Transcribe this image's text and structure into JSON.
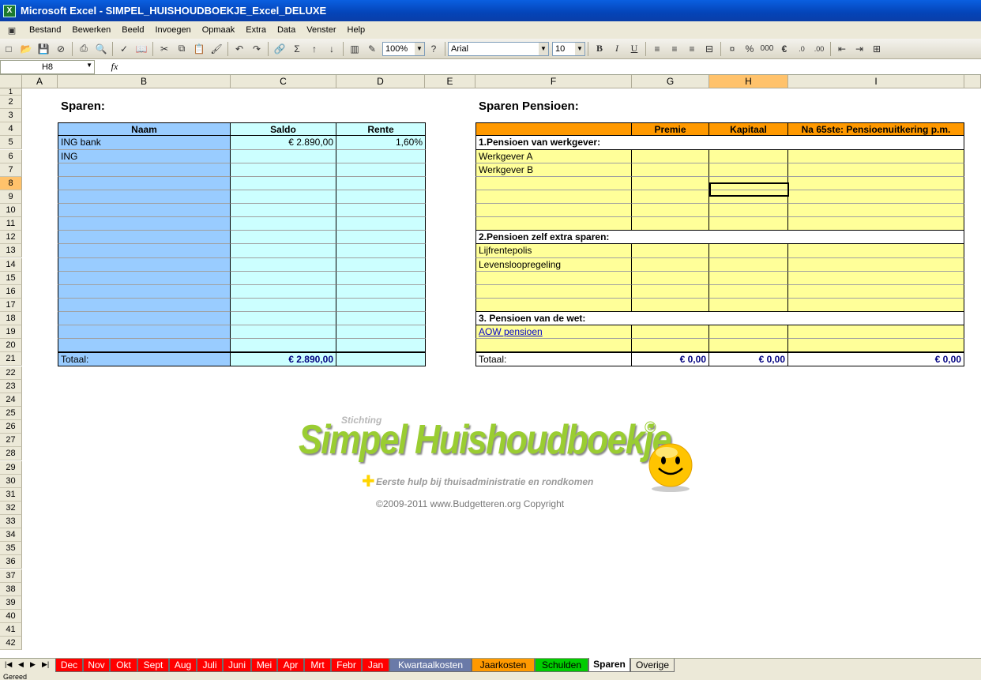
{
  "window": {
    "title": "Microsoft Excel - SIMPEL_HUISHOUDBOEKJE_Excel_DELUXE",
    "app_icon": "excel-icon"
  },
  "menu": [
    "Bestand",
    "Bewerken",
    "Beeld",
    "Invoegen",
    "Opmaak",
    "Extra",
    "Data",
    "Venster",
    "Help"
  ],
  "toolbar": {
    "zoom": "100%",
    "font": "Arial",
    "font_size": "10",
    "bold": "B",
    "italic": "I",
    "underline": "U",
    "percent": "%",
    "thousands": "000",
    "euro": "€"
  },
  "formula_bar": {
    "name_box": "H8",
    "fx": "fx",
    "content": ""
  },
  "columns": [
    "A",
    "B",
    "C",
    "D",
    "E",
    "F",
    "G",
    "H",
    "I"
  ],
  "selected_column": "H",
  "selected_row": 8,
  "rows": [
    "1",
    "2",
    "3",
    "4",
    "5",
    "6",
    "7",
    "8",
    "9",
    "10",
    "11",
    "12",
    "13",
    "14",
    "15",
    "16",
    "17",
    "18",
    "19",
    "20",
    "21",
    "22",
    "23",
    "24",
    "25",
    "26",
    "27",
    "28",
    "29",
    "30",
    "31",
    "32",
    "33",
    "34",
    "35",
    "36",
    "37",
    "38",
    "39",
    "40",
    "41",
    "42"
  ],
  "sparen": {
    "heading": "Sparen:",
    "headers": {
      "naam": "Naam",
      "saldo": "Saldo",
      "rente": "Rente"
    },
    "rows": [
      {
        "naam": "ING bank",
        "saldo": "€ 2.890,00",
        "rente": "1,60%"
      },
      {
        "naam": "ING",
        "saldo": "",
        "rente": ""
      }
    ],
    "total_label": "Totaal:",
    "total_saldo": "€ 2.890,00"
  },
  "pensioen": {
    "heading": "Sparen Pensioen:",
    "headers": {
      "premie": "Premie",
      "kapitaal": "Kapitaal",
      "uitkering": "Na 65ste: Pensioenuitkering p.m."
    },
    "section1": "1.Pensioen van werkgever:",
    "werkgever_a": "Werkgever A",
    "werkgever_b": "Werkgever B",
    "section2": "2.Pensioen zelf extra sparen:",
    "lijfrente": "Lijfrentepolis",
    "levensloop": "Levensloopregeling",
    "section3": "3. Pensioen van de wet:",
    "aow": "AOW pensioen",
    "total_label": "Totaal:",
    "total_premie": "€ 0,00",
    "total_kapitaal": "€ 0,00",
    "total_uitkering": "€ 0,00"
  },
  "logo": {
    "stichting": "Stichting",
    "title": "Simpel Huishoudboekje",
    "copyright_mark": "©",
    "tagline": "Eerste hulp bij thuisadministratie en rondkomen",
    "copyright": "©2009-2011 www.Budgetteren.org Copyright"
  },
  "tabs": [
    {
      "label": "Dec",
      "color": "#ff0000",
      "text": "#ffffff"
    },
    {
      "label": "Nov",
      "color": "#ff0000",
      "text": "#ffffff"
    },
    {
      "label": "Okt",
      "color": "#ff0000",
      "text": "#ffffff"
    },
    {
      "label": "Sept",
      "color": "#ff0000",
      "text": "#ffffff"
    },
    {
      "label": "Aug",
      "color": "#ff0000",
      "text": "#ffffff"
    },
    {
      "label": "Juli",
      "color": "#ff0000",
      "text": "#ffffff"
    },
    {
      "label": "Juni",
      "color": "#ff0000",
      "text": "#ffffff"
    },
    {
      "label": "Mei",
      "color": "#ff0000",
      "text": "#ffffff"
    },
    {
      "label": "Apr",
      "color": "#ff0000",
      "text": "#ffffff"
    },
    {
      "label": "Mrt",
      "color": "#ff0000",
      "text": "#ffffff"
    },
    {
      "label": "Febr",
      "color": "#ff0000",
      "text": "#ffffff"
    },
    {
      "label": "Jan",
      "color": "#ff0000",
      "text": "#ffffff"
    },
    {
      "label": "Kwartaalkosten",
      "color": "#6a7aa8",
      "text": "#ffffff"
    },
    {
      "label": "Jaarkosten",
      "color": "#ff9900",
      "text": "#000000"
    },
    {
      "label": "Schulden",
      "color": "#00cc00",
      "text": "#000000"
    },
    {
      "label": "Sparen",
      "color": "#ffffff",
      "text": "#000000"
    },
    {
      "label": "Overige",
      "color": "#ece9d8",
      "text": "#000000"
    }
  ],
  "status": "Gereed"
}
